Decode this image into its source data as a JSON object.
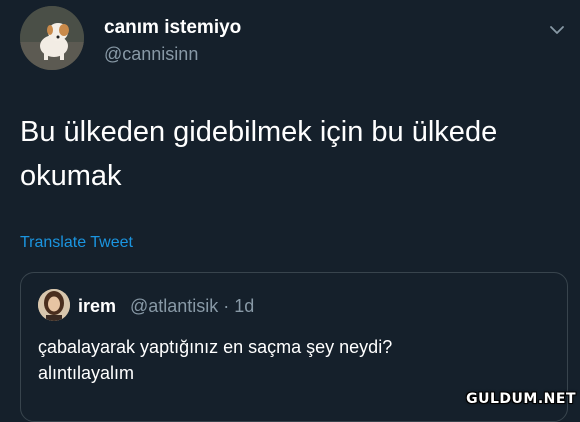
{
  "tweet": {
    "display_name": "canım istemiyo",
    "handle": "@cannisinn",
    "text_line1": "Bu ülkeden gidebilmek için bu ülkede",
    "text_line2": "okumak",
    "translate_link": "Translate Tweet",
    "avatar_icon": "puppy-photo",
    "menu_icon": "chevron-down-icon"
  },
  "quoted_tweet": {
    "display_name": "irem",
    "handle_time": "@atlantisik · 1d",
    "text_line1": "çabalayarak yaptığınız en saçma şey neydi?",
    "text_line2": "alıntılayalım",
    "avatar_icon": "woman-portrait-photo"
  },
  "watermark": "GULDUM.NET",
  "colors": {
    "background": "#15202b",
    "primary_text": "#ffffff",
    "secondary_text": "#8899a6",
    "link": "#1b95e0",
    "border": "#38444d"
  }
}
